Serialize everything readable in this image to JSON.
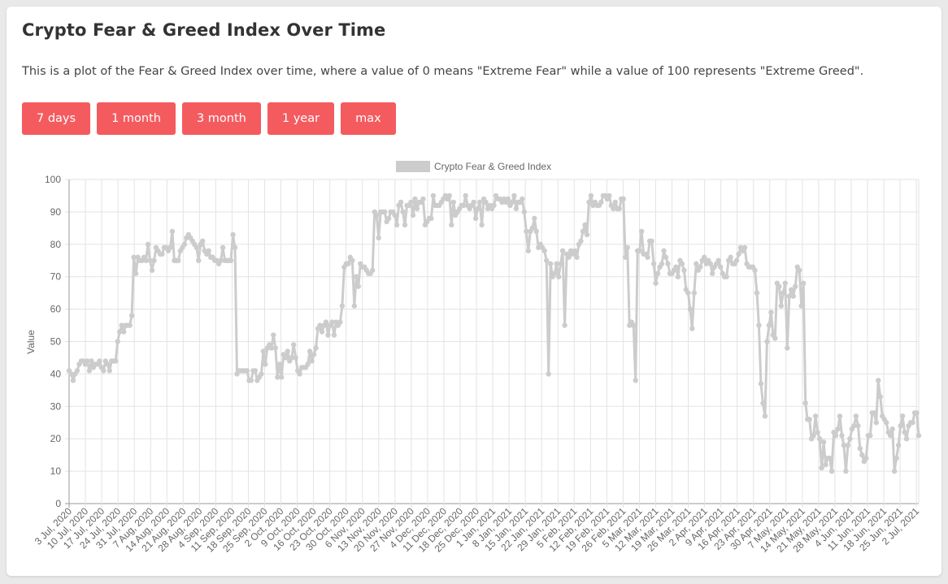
{
  "page": {
    "title": "Crypto Fear & Greed Index Over Time",
    "description": "This is a plot of the Fear & Greed Index over time, where a value of 0 means \"Extreme Fear\" while a value of 100 represents \"Extreme Greed\".",
    "buttons": [
      {
        "label": "7 days"
      },
      {
        "label": "1 month"
      },
      {
        "label": "3 month"
      },
      {
        "label": "1 year"
      },
      {
        "label": "max"
      }
    ],
    "accent_color": "#f45b5f"
  },
  "chart_data": {
    "type": "line",
    "title": "",
    "legend": [
      "Crypto Fear & Greed Index"
    ],
    "legend_position": "top",
    "xlabel": "",
    "ylabel": "Value",
    "ylim": [
      0,
      100
    ],
    "yticks": [
      0,
      10,
      20,
      30,
      40,
      50,
      60,
      70,
      80,
      90,
      100
    ],
    "grid": true,
    "line_color": "#cccccc",
    "start_date": "3 Jul, 2020",
    "xticks": [
      "3 Jul, 2020",
      "10 Jul, 2020",
      "17 Jul, 2020",
      "24 Jul, 2020",
      "31 Jul, 2020",
      "7 Aug, 2020",
      "14 Aug, 2020",
      "21 Aug, 2020",
      "28 Aug, 2020",
      "4 Sep, 2020",
      "11 Sep, 2020",
      "18 Sep, 2020",
      "25 Sep, 2020",
      "2 Oct, 2020",
      "9 Oct, 2020",
      "16 Oct, 2020",
      "23 Oct, 2020",
      "30 Oct, 2020",
      "6 Nov, 2020",
      "13 Nov, 2020",
      "20 Nov, 2020",
      "27 Nov, 2020",
      "4 Dec, 2020",
      "11 Dec, 2020",
      "18 Dec, 2020",
      "25 Dec, 2020",
      "1 Jan, 2021",
      "8 Jan, 2021",
      "15 Jan, 2021",
      "22 Jan, 2021",
      "29 Jan, 2021",
      "5 Feb, 2021",
      "12 Feb, 2021",
      "19 Feb, 2021",
      "26 Feb, 2021",
      "5 Mar, 2021",
      "12 Mar, 2021",
      "19 Mar, 2021",
      "26 Mar, 2021",
      "2 Apr, 2021",
      "9 Apr, 2021",
      "16 Apr, 2021",
      "23 Apr, 2021",
      "30 Apr, 2021",
      "7 May, 2021",
      "14 May, 2021",
      "21 May, 2021",
      "28 May, 2021",
      "4 Jun, 2021",
      "11 Jun, 2021",
      "18 Jun, 2021",
      "25 Jun, 2021",
      "2 Jul, 2021"
    ],
    "series": [
      {
        "name": "Crypto Fear & Greed Index",
        "values": [
          41,
          40,
          38,
          40,
          41,
          43,
          44,
          44,
          43,
          44,
          41,
          44,
          42,
          43,
          43,
          44,
          42,
          41,
          44,
          43,
          41,
          44,
          44,
          44,
          50,
          53,
          55,
          53,
          55,
          55,
          55,
          58,
          76,
          71,
          76,
          75,
          75,
          76,
          75,
          80,
          75,
          72,
          75,
          79,
          78,
          77,
          77,
          79,
          79,
          78,
          79,
          84,
          75,
          75,
          75,
          78,
          79,
          80,
          82,
          83,
          82,
          81,
          80,
          79,
          75,
          80,
          81,
          78,
          77,
          78,
          76,
          76,
          75,
          75,
          74,
          75,
          79,
          75,
          75,
          75,
          75,
          83,
          79,
          40,
          41,
          41,
          41,
          41,
          41,
          38,
          38,
          41,
          41,
          38,
          39,
          40,
          47,
          43,
          48,
          49,
          48,
          52,
          48,
          39,
          43,
          39,
          46,
          45,
          47,
          44,
          45,
          49,
          45,
          41,
          40,
          42,
          42,
          42,
          43,
          47,
          44,
          46,
          48,
          54,
          55,
          53,
          55,
          56,
          52,
          55,
          56,
          52,
          56,
          55,
          56,
          61,
          73,
          74,
          74,
          76,
          75,
          61,
          70,
          67,
          74,
          73,
          73,
          72,
          71,
          71,
          72,
          90,
          89,
          82,
          90,
          90,
          90,
          87,
          88,
          90,
          90,
          89,
          86,
          92,
          93,
          90,
          86,
          92,
          92,
          93,
          89,
          94,
          91,
          93,
          93,
          94,
          86,
          87,
          88,
          88,
          95,
          92,
          92,
          92,
          93,
          94,
          95,
          94,
          95,
          86,
          93,
          89,
          90,
          91,
          92,
          92,
          95,
          92,
          91,
          92,
          93,
          88,
          91,
          93,
          86,
          94,
          93,
          91,
          92,
          91,
          92,
          95,
          94,
          94,
          93,
          94,
          93,
          94,
          92,
          93,
          95,
          91,
          93,
          93,
          94,
          90,
          84,
          78,
          84,
          85,
          88,
          84,
          79,
          80,
          79,
          78,
          75,
          40,
          74,
          70,
          71,
          74,
          70,
          74,
          78,
          55,
          77,
          76,
          78,
          77,
          78,
          76,
          80,
          81,
          84,
          86,
          83,
          93,
          95,
          92,
          93,
          92,
          92,
          93,
          95,
          95,
          94,
          95,
          92,
          91,
          93,
          91,
          91,
          94,
          94,
          76,
          79,
          55,
          56,
          55,
          38,
          78,
          78,
          84,
          77,
          77,
          76,
          81,
          81,
          74,
          68,
          71,
          73,
          74,
          78,
          76,
          74,
          71,
          71,
          72,
          73,
          70,
          75,
          74,
          72,
          66,
          65,
          60,
          54,
          65,
          74,
          72,
          73,
          75,
          76,
          74,
          75,
          74,
          71,
          73,
          74,
          75,
          73,
          71,
          70,
          70,
          75,
          76,
          74,
          74,
          75,
          77,
          79,
          78,
          79,
          74,
          73,
          73,
          73,
          72,
          65,
          55,
          37,
          31,
          27,
          50,
          55,
          59,
          52,
          51,
          68,
          67,
          61,
          65,
          68,
          48,
          64,
          66,
          64,
          67,
          73,
          72,
          61,
          68,
          31,
          26,
          26,
          20,
          21,
          27,
          22,
          20,
          11,
          19,
          12,
          14,
          14,
          10,
          22,
          21,
          23,
          27,
          21,
          18,
          10,
          18,
          20,
          23,
          24,
          27,
          24,
          17,
          15,
          13,
          14,
          21,
          21,
          28,
          28,
          25,
          38,
          33,
          27,
          26,
          25,
          22,
          21,
          23,
          10,
          14,
          18,
          24,
          27,
          22,
          20,
          24,
          25,
          25,
          28,
          28,
          21
        ]
      }
    ]
  }
}
